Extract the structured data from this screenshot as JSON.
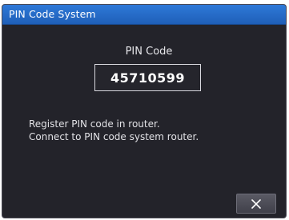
{
  "window": {
    "title": "PIN Code System"
  },
  "pin": {
    "label": "PIN Code",
    "value": "45710599"
  },
  "message": {
    "line1": "Register PIN code in router.",
    "line2": "Connect to PIN code system router."
  },
  "close_button": {
    "icon": "close-icon"
  }
}
